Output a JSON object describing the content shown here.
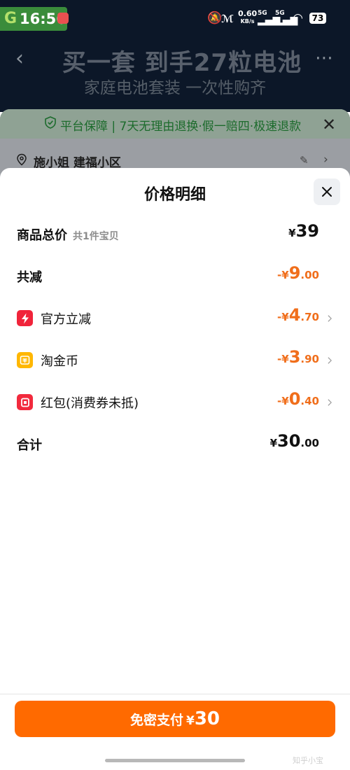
{
  "status_bar": {
    "app_badge_letter": "G",
    "time": "16:56",
    "net_speed": "0.60",
    "net_unit": "KB/s",
    "signal1": "5G",
    "signal2": "5G",
    "battery": "73"
  },
  "background": {
    "banner_title": "买一套 到手27粒电池",
    "banner_subtitle": "家庭电池套装 一次性购齐",
    "guarantee": "平台保障 | 7天无理由退换·假一赔四·极速退款",
    "address": "施小姐 建福小区"
  },
  "modal": {
    "title": "价格明细",
    "rows": [
      {
        "label": "商品总价",
        "sub": "共1件宝贝",
        "currency": "¥",
        "int": "39",
        "dec": ""
      },
      {
        "label": "共减",
        "currency": "-¥",
        "int": "9",
        "dec": ".00"
      },
      {
        "label": "官方立减",
        "currency": "-¥",
        "int": "4",
        "dec": ".70"
      },
      {
        "label": "淘金币",
        "currency": "-¥",
        "int": "3",
        "dec": ".90"
      },
      {
        "label": "红包(消费券未抵)",
        "currency": "-¥",
        "int": "0",
        "dec": ".40"
      },
      {
        "label": "合计",
        "currency": "¥",
        "int": "30",
        "dec": ".00"
      }
    ]
  },
  "pay": {
    "label": "免密支付",
    "currency": "¥",
    "amount": "30"
  },
  "icons": {
    "official": "lightning-icon",
    "coin": "coin-icon",
    "redpacket": "red-packet-icon"
  },
  "colors": {
    "accent": "#ff6a00",
    "discount": "#f06e1b",
    "official_icon": "#f0243a",
    "coin_icon": "#ffb700",
    "redpacket_icon": "#f22a3d"
  },
  "watermark": "知乎小宝"
}
